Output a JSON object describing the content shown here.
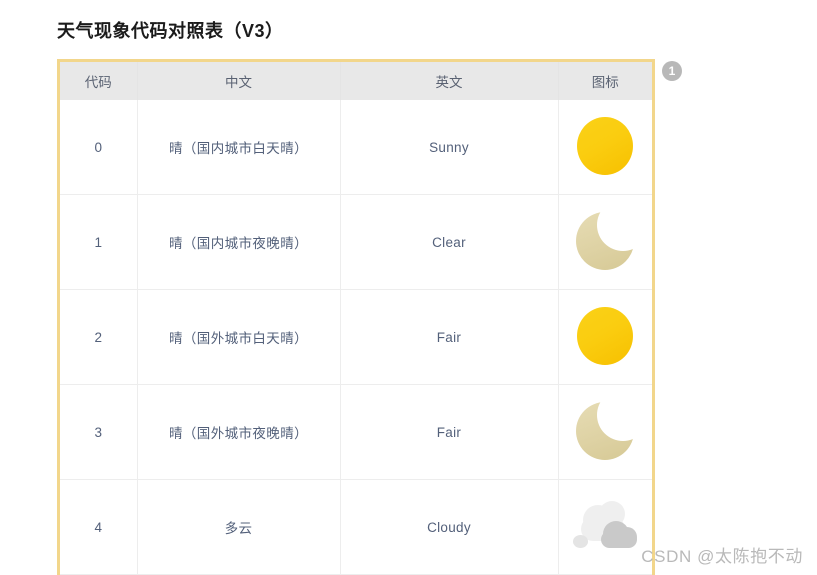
{
  "page": {
    "title": "天气现象代码对照表（V3）",
    "watermark": "CSDN @太陈抱不动",
    "annotation_badge": "1"
  },
  "colors": {
    "table_border": "#F2D68B",
    "header_bg": "#E8E8E8",
    "text": "#4F5B70",
    "sun": "#FACD10",
    "moon": "#DED2A4",
    "cloud_back": "#EFEFEF",
    "cloud_front": "#C9C9C9",
    "watermark": "#B9B9B9"
  },
  "table": {
    "headers": [
      "代码",
      "中文",
      "英文",
      "图标"
    ],
    "rows": [
      {
        "code": "0",
        "chinese": "晴（国内城市白天晴）",
        "english": "Sunny",
        "icon": "sun-icon"
      },
      {
        "code": "1",
        "chinese": "晴（国内城市夜晚晴）",
        "english": "Clear",
        "icon": "moon-icon"
      },
      {
        "code": "2",
        "chinese": "晴（国外城市白天晴）",
        "english": "Fair",
        "icon": "sun-icon"
      },
      {
        "code": "3",
        "chinese": "晴（国外城市夜晚晴）",
        "english": "Fair",
        "icon": "moon-icon"
      },
      {
        "code": "4",
        "chinese": "多云",
        "english": "Cloudy",
        "icon": "cloudy-icon"
      }
    ]
  }
}
